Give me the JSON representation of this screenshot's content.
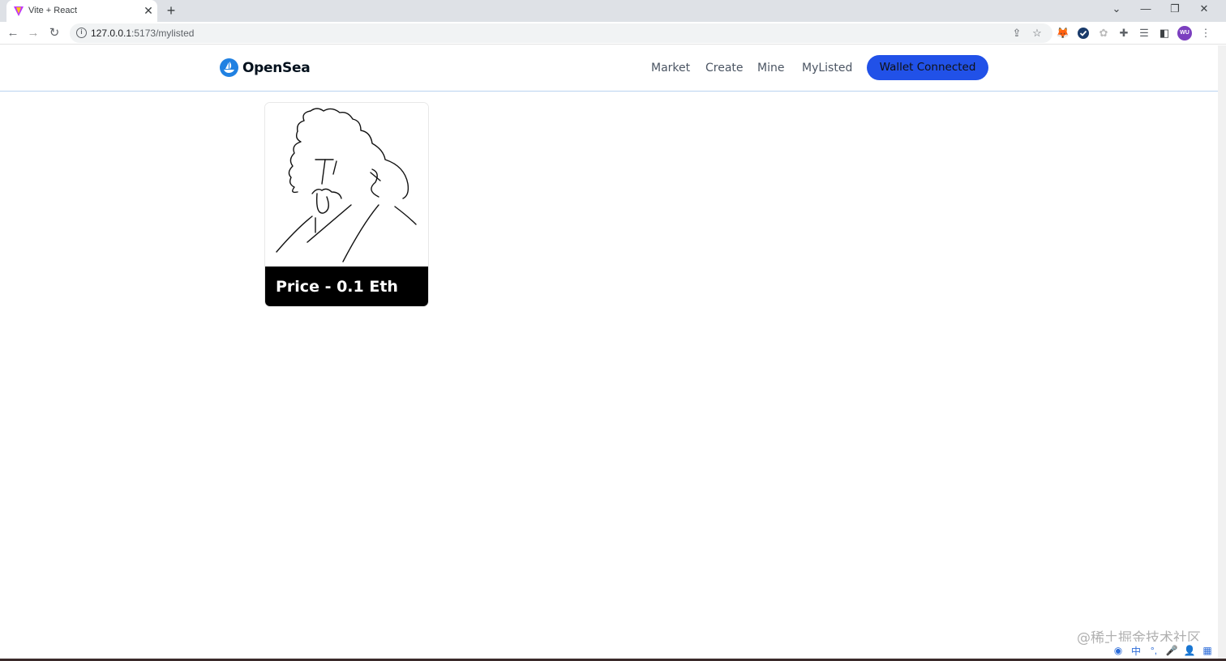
{
  "browser": {
    "tab_title": "Vite + React",
    "tab_close": "✕",
    "new_tab": "+",
    "url_host": "127.0.0.1",
    "url_path": ":5173/mylisted",
    "profile_initials": "WU",
    "icons": [
      "back-icon",
      "forward-icon",
      "reload-icon",
      "info-icon",
      "share-icon",
      "star-icon",
      "metamask-icon",
      "check-icon",
      "extension-icon",
      "puzzle-icon",
      "reading-list-icon",
      "sidepanel-icon",
      "menu-icon"
    ]
  },
  "header": {
    "brand": "OpenSea",
    "nav": [
      {
        "label": "Market"
      },
      {
        "label": "Create"
      },
      {
        "label": "Mine"
      },
      {
        "label": "MyListed"
      }
    ],
    "wallet_button": "Wallet Connected",
    "accent_color": "#2151e8"
  },
  "cards": [
    {
      "price_text": "Price - 0.1 Eth",
      "image": "line drawing portrait"
    }
  ],
  "watermark": "@稀土掘金技术社区",
  "ime": [
    "中",
    "°,",
    "mic-icon",
    "user-icon",
    "grid-icon"
  ]
}
